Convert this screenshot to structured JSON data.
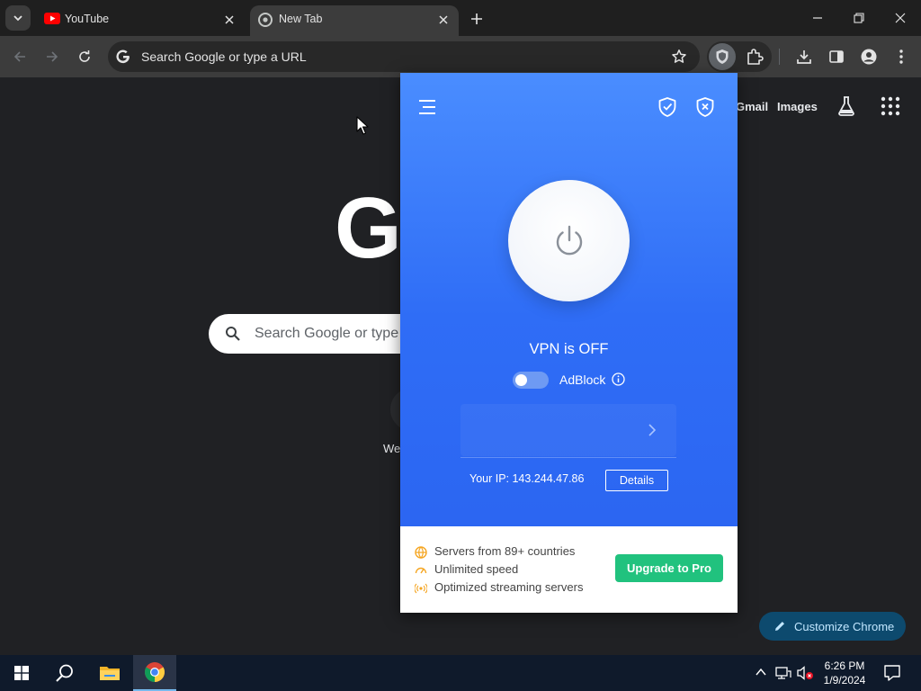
{
  "browser": {
    "tabs": [
      {
        "title": "YouTube",
        "icon": "youtube-icon",
        "active": false
      },
      {
        "title": "New Tab",
        "icon": "chrome-icon",
        "active": true
      }
    ],
    "omnibox_placeholder": "Search Google or type a URL"
  },
  "ntp": {
    "header_links": {
      "gmail": "Gmail",
      "images": "Images"
    },
    "logo_fragment": "G",
    "search_placeholder": "Search Google or type",
    "partial_text": "We",
    "customize_label": "Customize Chrome"
  },
  "vpn_popup": {
    "status": "VPN is OFF",
    "adblock_label": "AdBlock",
    "adblock_enabled": false,
    "ip_label": "Your IP: 143.244.47.86",
    "details_label": "Details",
    "features": [
      {
        "icon": "globe-icon",
        "text": "Servers from 89+ countries"
      },
      {
        "icon": "speedometer-icon",
        "text": "Unlimited speed"
      },
      {
        "icon": "broadcast-icon",
        "text": "Optimized streaming servers"
      }
    ],
    "upgrade_label": "Upgrade to Pro",
    "colors": {
      "primary": "#2f6df6",
      "accent": "#21c27e",
      "feature_icon": "#f5a623"
    }
  },
  "taskbar": {
    "time": "6:26 PM",
    "date": "1/9/2024"
  }
}
